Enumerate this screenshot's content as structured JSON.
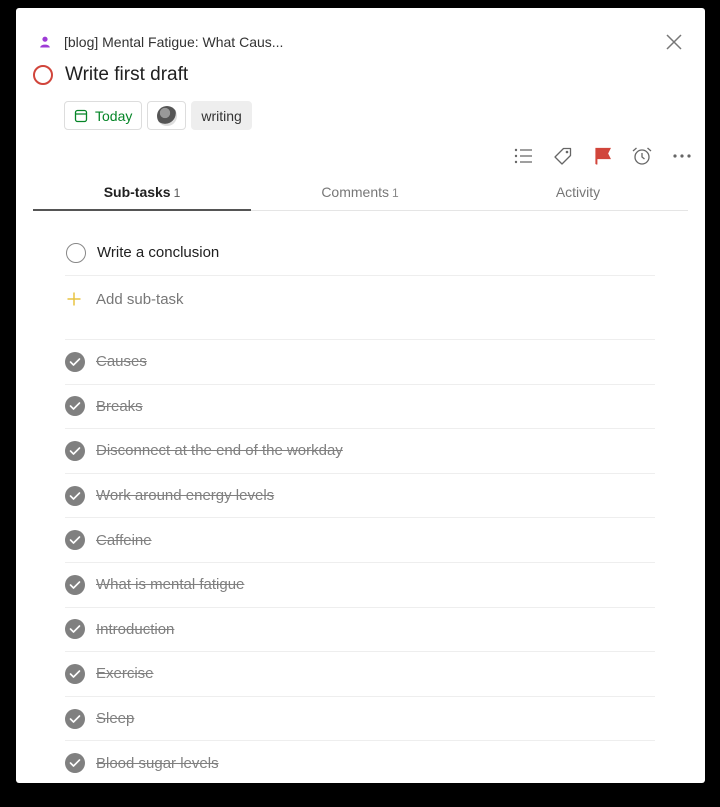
{
  "header": {
    "breadcrumb": "[blog] Mental Fatigue: What Caus...",
    "person_icon": "person-icon",
    "close_icon": "close-icon"
  },
  "task": {
    "title": "Write first draft",
    "priority_color": "#d1453b"
  },
  "chips": {
    "date_label": "Today",
    "date_color": "#058527",
    "label": "writing"
  },
  "actions": [
    {
      "icon": "subtasks-list-icon"
    },
    {
      "icon": "label-tag-icon"
    },
    {
      "icon": "priority-flag-icon",
      "color": "#d1453b"
    },
    {
      "icon": "reminder-alarm-icon"
    },
    {
      "icon": "more-icon"
    }
  ],
  "tabs": [
    {
      "label": "Sub-tasks",
      "count": "1",
      "active": true
    },
    {
      "label": "Comments",
      "count": "1",
      "active": false
    },
    {
      "label": "Activity",
      "count": "",
      "active": false
    }
  ],
  "subtasks": {
    "open": [
      {
        "text": "Write a conclusion"
      }
    ],
    "add_label": "Add sub-task",
    "add_color": "#e8c340",
    "completed": [
      {
        "text": "Causes"
      },
      {
        "text": "Breaks"
      },
      {
        "text": "Disconnect at the end of the workday"
      },
      {
        "text": "Work around energy levels"
      },
      {
        "text": "Caffeine"
      },
      {
        "text": "What is mental fatigue"
      },
      {
        "text": "Introduction"
      },
      {
        "text": "Exercise"
      },
      {
        "text": "Sleep"
      },
      {
        "text": "Blood sugar levels"
      }
    ]
  }
}
